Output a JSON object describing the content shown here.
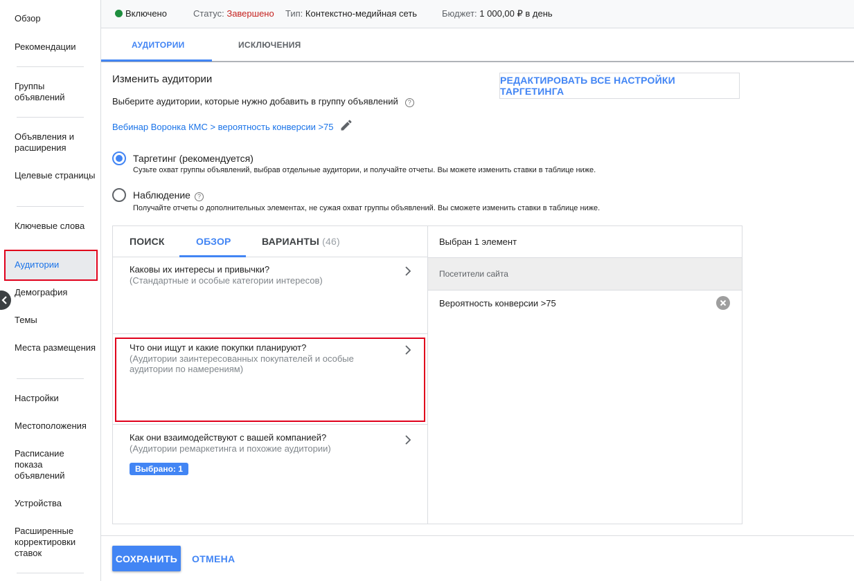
{
  "sidebar": {
    "items": [
      {
        "label": "Обзор"
      },
      {
        "label": "Рекомендации"
      },
      {
        "label": "Группы объявлений"
      },
      {
        "label": "Объявления и расширения"
      },
      {
        "label": "Целевые страницы"
      },
      {
        "label": "Ключевые слова"
      },
      {
        "label": "Аудитории"
      },
      {
        "label": "Демография"
      },
      {
        "label": "Темы"
      },
      {
        "label": "Места размещения"
      },
      {
        "label": "Настройки"
      },
      {
        "label": "Местоположения"
      },
      {
        "label": "Расписание показа объявлений"
      },
      {
        "label": "Устройства"
      },
      {
        "label": "Расширенные корректировки ставок"
      }
    ],
    "active_item": "Аудитории",
    "collapse_icon": "chevron-left-icon"
  },
  "topbar": {
    "enabled": "Включено",
    "status_label": "Статус:",
    "status_value": "Завершено",
    "status_color": "#c5221f",
    "type_label": "Тип:",
    "type_value": "Контекстно-медийная сеть",
    "budget_label": "Бюджет:",
    "budget_value": "1 000,00 ₽ в день"
  },
  "tabs": [
    {
      "label": "АУДИТОРИИ",
      "active": true
    },
    {
      "label": "ИСКЛЮЧЕНИЯ",
      "active": false
    }
  ],
  "main": {
    "title": "Изменить аудитории",
    "help_text": "Выберите аудитории, которые нужно добавить в группу объявлений",
    "help_icon": "?",
    "edit_all_button": "РЕДАКТИРОВАТЬ ВСЕ НАСТРОЙКИ ТАРГЕТИНГА",
    "breadcrumb": "Вебинар Воронка КМС > вероятность конверсии >75",
    "options": [
      {
        "label": "Таргетинг (рекомендуется)",
        "desc": "Сузьте охват группы объявлений, выбрав отдельные аудитории, и получайте отчеты. Вы можете изменить ставки в таблице ниже.",
        "selected": true
      },
      {
        "label": "Наблюдение",
        "desc": "Получайте отчеты о дополнительных элементах, не сужая охват группы объявлений. Вы сможете изменить ставки в таблице ниже.",
        "selected": false
      }
    ]
  },
  "browse": {
    "tabs": [
      {
        "label": "ПОИСК"
      },
      {
        "label": "ОБЗОР",
        "active": true
      },
      {
        "label": "ВАРИАНТЫ",
        "count": "(46)"
      }
    ],
    "categories": [
      {
        "title": "Каковы их интересы и привычки?",
        "sub": "(Стандартные и особые категории интересов)"
      },
      {
        "title": "Что они ищут и какие покупки планируют?",
        "sub": "(Аудитории заинтересованных покупателей и особые аудитории по намерениям)"
      },
      {
        "title": "Как они взаимодействуют с вашей компанией?",
        "sub": "(Аудитории ремаркетинга и похожие аудитории)",
        "chip": "Выбрано: 1"
      }
    ]
  },
  "selected": {
    "count_text": "Выбран 1 элемент",
    "group": "Посетители сайта",
    "item": "Вероятность конверсии >75"
  },
  "footer": {
    "save": "СОХРАНИТЬ",
    "cancel": "ОТМЕНА"
  },
  "colors": {
    "accent": "#4285f4",
    "highlight": "#e0001b",
    "enabled_dot": "#1e8e3e"
  }
}
